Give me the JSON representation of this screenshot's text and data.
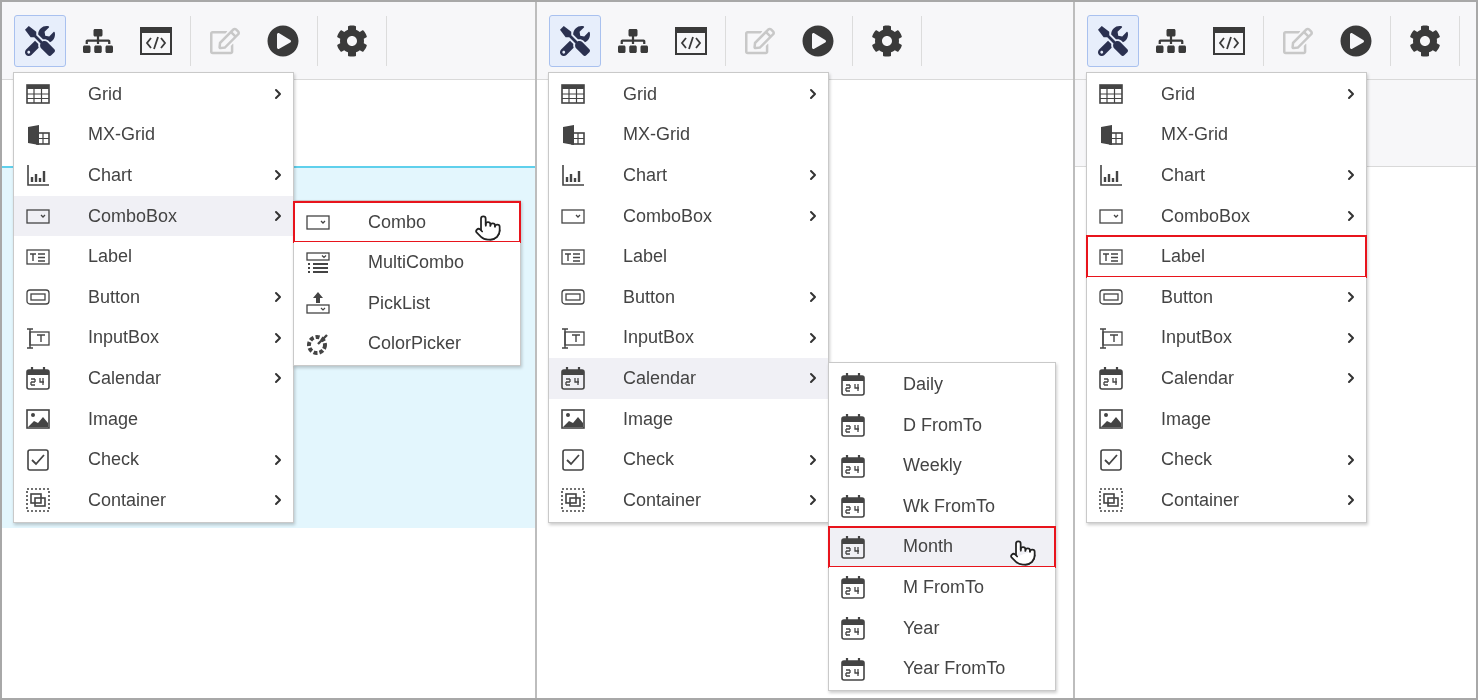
{
  "panels": [
    {
      "kind": "cyan-band",
      "toolbar": [
        {
          "kind": "tools",
          "selected": true,
          "disabled": false
        },
        {
          "kind": "hierarchy",
          "selected": false,
          "disabled": false
        },
        {
          "kind": "code",
          "selected": false,
          "disabled": false
        },
        {
          "kind": "separator"
        },
        {
          "kind": "edit",
          "selected": false,
          "disabled": true
        },
        {
          "kind": "play",
          "selected": false,
          "disabled": false
        },
        {
          "kind": "separator"
        },
        {
          "kind": "settings",
          "selected": false,
          "disabled": false
        },
        {
          "kind": "separator"
        }
      ],
      "menu": [
        {
          "kind": "grid",
          "label": "Grid",
          "submenu": true,
          "hovered": false,
          "outlined": false
        },
        {
          "kind": "mxgrid",
          "label": "MX-Grid",
          "submenu": false,
          "hovered": false,
          "outlined": false
        },
        {
          "kind": "chart",
          "label": "Chart",
          "submenu": true,
          "hovered": false,
          "outlined": false
        },
        {
          "kind": "combo",
          "label": "ComboBox",
          "submenu": true,
          "hovered": true,
          "outlined": false,
          "children": [
            {
              "kind": "combo",
              "label": "Combo",
              "hovered": false,
              "outlined": true,
              "cursor": true
            },
            {
              "kind": "multicombo",
              "label": "MultiCombo",
              "hovered": false,
              "outlined": false,
              "cursor": false
            },
            {
              "kind": "picklist",
              "label": "PickList",
              "hovered": false,
              "outlined": false,
              "cursor": false
            },
            {
              "kind": "colorpicker",
              "label": "ColorPicker",
              "hovered": false,
              "outlined": false,
              "cursor": false
            }
          ]
        },
        {
          "kind": "label",
          "label": "Label",
          "submenu": false,
          "hovered": false,
          "outlined": false
        },
        {
          "kind": "button",
          "label": "Button",
          "submenu": true,
          "hovered": false,
          "outlined": false
        },
        {
          "kind": "input",
          "label": "InputBox",
          "submenu": true,
          "hovered": false,
          "outlined": false
        },
        {
          "kind": "calendar",
          "label": "Calendar",
          "submenu": true,
          "hovered": false,
          "outlined": false
        },
        {
          "kind": "image",
          "label": "Image",
          "submenu": false,
          "hovered": false,
          "outlined": false
        },
        {
          "kind": "check",
          "label": "Check",
          "submenu": true,
          "hovered": false,
          "outlined": false
        },
        {
          "kind": "container",
          "label": "Container",
          "submenu": true,
          "hovered": false,
          "outlined": false
        }
      ]
    },
    {
      "kind": "plain",
      "toolbar": [
        {
          "kind": "tools",
          "selected": true,
          "disabled": false
        },
        {
          "kind": "hierarchy",
          "selected": false,
          "disabled": false
        },
        {
          "kind": "code",
          "selected": false,
          "disabled": false
        },
        {
          "kind": "separator"
        },
        {
          "kind": "edit",
          "selected": false,
          "disabled": true
        },
        {
          "kind": "play",
          "selected": false,
          "disabled": false
        },
        {
          "kind": "separator"
        },
        {
          "kind": "settings",
          "selected": false,
          "disabled": false
        },
        {
          "kind": "separator"
        }
      ],
      "menu": [
        {
          "kind": "grid",
          "label": "Grid",
          "submenu": true,
          "hovered": false,
          "outlined": false
        },
        {
          "kind": "mxgrid",
          "label": "MX-Grid",
          "submenu": false,
          "hovered": false,
          "outlined": false
        },
        {
          "kind": "chart",
          "label": "Chart",
          "submenu": true,
          "hovered": false,
          "outlined": false
        },
        {
          "kind": "combo",
          "label": "ComboBox",
          "submenu": true,
          "hovered": false,
          "outlined": false
        },
        {
          "kind": "label",
          "label": "Label",
          "submenu": false,
          "hovered": false,
          "outlined": false
        },
        {
          "kind": "button",
          "label": "Button",
          "submenu": true,
          "hovered": false,
          "outlined": false
        },
        {
          "kind": "input",
          "label": "InputBox",
          "submenu": true,
          "hovered": false,
          "outlined": false
        },
        {
          "kind": "calendar",
          "label": "Calendar",
          "submenu": true,
          "hovered": true,
          "outlined": false,
          "children": [
            {
              "kind": "calendar",
              "label": "Daily",
              "hovered": false,
              "outlined": false,
              "cursor": false
            },
            {
              "kind": "calendar",
              "label": "D FromTo",
              "hovered": false,
              "outlined": false,
              "cursor": false
            },
            {
              "kind": "calendar",
              "label": "Weekly",
              "hovered": false,
              "outlined": false,
              "cursor": false
            },
            {
              "kind": "calendar",
              "label": "Wk FromTo",
              "hovered": false,
              "outlined": false,
              "cursor": false
            },
            {
              "kind": "calendar",
              "label": "Month",
              "hovered": true,
              "outlined": true,
              "cursor": true
            },
            {
              "kind": "calendar",
              "label": "M FromTo",
              "hovered": false,
              "outlined": false,
              "cursor": false
            },
            {
              "kind": "calendar",
              "label": "Year",
              "hovered": false,
              "outlined": false,
              "cursor": false
            },
            {
              "kind": "calendar",
              "label": "Year FromTo",
              "hovered": false,
              "outlined": false,
              "cursor": false
            }
          ]
        },
        {
          "kind": "image",
          "label": "Image",
          "submenu": false,
          "hovered": false,
          "outlined": false
        },
        {
          "kind": "check",
          "label": "Check",
          "submenu": true,
          "hovered": false,
          "outlined": false
        },
        {
          "kind": "container",
          "label": "Container",
          "submenu": true,
          "hovered": false,
          "outlined": false
        }
      ]
    },
    {
      "kind": "grey-band",
      "toolbar": [
        {
          "kind": "tools",
          "selected": true,
          "disabled": false
        },
        {
          "kind": "hierarchy",
          "selected": false,
          "disabled": false
        },
        {
          "kind": "code",
          "selected": false,
          "disabled": false
        },
        {
          "kind": "separator"
        },
        {
          "kind": "edit",
          "selected": false,
          "disabled": true
        },
        {
          "kind": "play",
          "selected": false,
          "disabled": false
        },
        {
          "kind": "separator"
        },
        {
          "kind": "settings",
          "selected": false,
          "disabled": false
        },
        {
          "kind": "separator"
        }
      ],
      "menu": [
        {
          "kind": "grid",
          "label": "Grid",
          "submenu": true,
          "hovered": false,
          "outlined": false
        },
        {
          "kind": "mxgrid",
          "label": "MX-Grid",
          "submenu": false,
          "hovered": false,
          "outlined": false
        },
        {
          "kind": "chart",
          "label": "Chart",
          "submenu": true,
          "hovered": false,
          "outlined": false
        },
        {
          "kind": "combo",
          "label": "ComboBox",
          "submenu": true,
          "hovered": false,
          "outlined": false
        },
        {
          "kind": "label",
          "label": "Label",
          "submenu": false,
          "hovered": false,
          "outlined": true
        },
        {
          "kind": "button",
          "label": "Button",
          "submenu": true,
          "hovered": false,
          "outlined": false
        },
        {
          "kind": "input",
          "label": "InputBox",
          "submenu": true,
          "hovered": false,
          "outlined": false
        },
        {
          "kind": "calendar",
          "label": "Calendar",
          "submenu": true,
          "hovered": false,
          "outlined": false
        },
        {
          "kind": "image",
          "label": "Image",
          "submenu": false,
          "hovered": false,
          "outlined": false
        },
        {
          "kind": "check",
          "label": "Check",
          "submenu": true,
          "hovered": false,
          "outlined": false
        },
        {
          "kind": "container",
          "label": "Container",
          "submenu": true,
          "hovered": false,
          "outlined": false
        }
      ]
    }
  ]
}
